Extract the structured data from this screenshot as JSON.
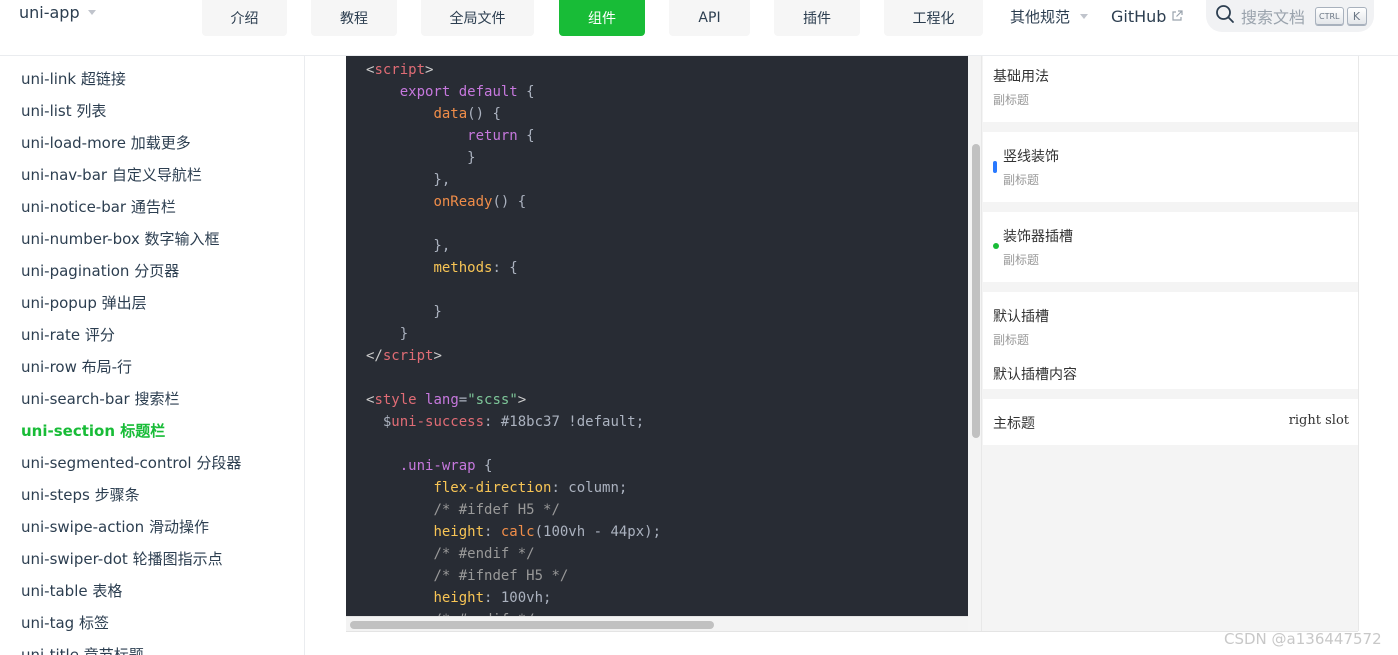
{
  "brand": {
    "name": "uni-app"
  },
  "nav": {
    "items": [
      "介绍",
      "教程",
      "全局文件",
      "组件",
      "API",
      "插件",
      "工程化"
    ],
    "active": "组件",
    "more": "其他规范",
    "github": "GitHub",
    "search_placeholder": "搜索文档",
    "kbd_ctrl": "CTRL",
    "kbd_k": "K"
  },
  "sidebar": {
    "items": [
      "uni-link 超链接",
      "uni-list 列表",
      "uni-load-more 加载更多",
      "uni-nav-bar 自定义导航栏",
      "uni-notice-bar 通告栏",
      "uni-number-box 数字输入框",
      "uni-pagination 分页器",
      "uni-popup 弹出层",
      "uni-rate 评分",
      "uni-row 布局-行",
      "uni-search-bar 搜索栏",
      "uni-section 标题栏",
      "uni-segmented-control 分段器",
      "uni-steps 步骤条",
      "uni-swipe-action 滑动操作",
      "uni-swiper-dot 轮播图指示点",
      "uni-table 表格",
      "uni-tag 标签",
      "uni-title 章节标题"
    ],
    "active_index": 11
  },
  "preview": {
    "sections": [
      {
        "title": "基础用法",
        "subtitle": "副标题"
      },
      {
        "title": "竖线装饰",
        "subtitle": "副标题"
      },
      {
        "title": "装饰器插槽",
        "subtitle": "副标题"
      },
      {
        "title": "默认插槽",
        "subtitle": "副标题",
        "content": "默认插槽内容"
      },
      {
        "title": "主标题",
        "right": "right slot"
      }
    ]
  },
  "colors": {
    "primary": "#18bc37",
    "code_bg": "#282c34",
    "decor_line": "#2979ff"
  },
  "watermark": "CSDN @a136447572"
}
